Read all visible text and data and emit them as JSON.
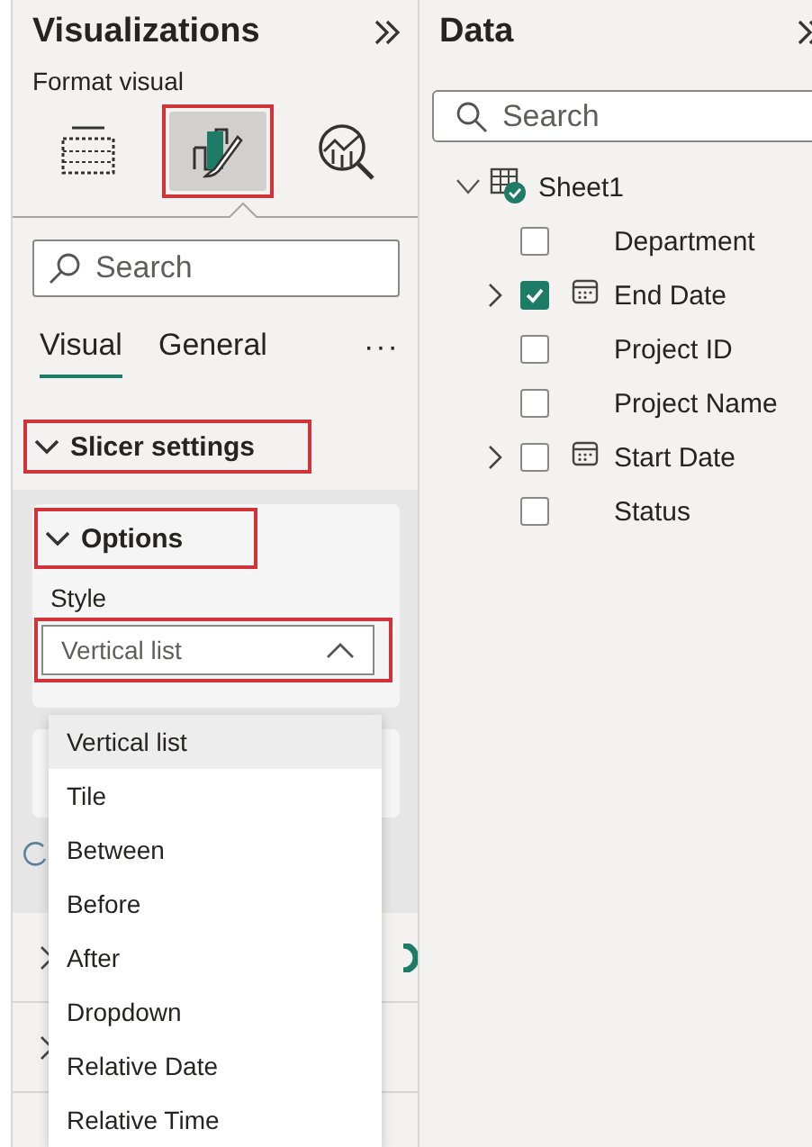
{
  "visualizations": {
    "title": "Visualizations",
    "subtitle": "Format visual",
    "icons": [
      {
        "kind": "build",
        "selected": false,
        "highlighted": false
      },
      {
        "kind": "format",
        "selected": true,
        "highlighted": true
      },
      {
        "kind": "analytics",
        "selected": false,
        "highlighted": false
      }
    ],
    "search": {
      "placeholder": "Search"
    },
    "tabs": [
      {
        "label": "Visual",
        "selected": true
      },
      {
        "label": "General",
        "selected": false
      }
    ],
    "more": "···",
    "section": {
      "title": "Slicer settings",
      "expanded": true,
      "highlighted": true
    },
    "options": {
      "title": "Options",
      "expanded": true,
      "highlighted": true
    },
    "style": {
      "label": "Style",
      "value": "Vertical list",
      "open": true,
      "highlighted": true
    },
    "collapsed_rows": [
      {
        "kind": "toggle"
      },
      {
        "kind": "plain"
      }
    ],
    "dropdown_options": [
      {
        "label": "Vertical list",
        "selected": true
      },
      {
        "label": "Tile",
        "selected": false
      },
      {
        "label": "Between",
        "selected": false
      },
      {
        "label": "Before",
        "selected": false
      },
      {
        "label": "After",
        "selected": false
      },
      {
        "label": "Dropdown",
        "selected": false
      },
      {
        "label": "Relative Date",
        "selected": false
      },
      {
        "label": "Relative Time",
        "selected": false
      }
    ]
  },
  "data": {
    "title": "Data",
    "search": {
      "placeholder": "Search"
    },
    "tree": [
      {
        "label": "Sheet1",
        "expanded": true,
        "children": [
          {
            "label": "Department",
            "kind": "field",
            "checked": false
          },
          {
            "label": "End Date",
            "kind": "date",
            "checked": true,
            "expanded": false
          },
          {
            "label": "Project ID",
            "kind": "field",
            "checked": false
          },
          {
            "label": "Project Name",
            "kind": "field",
            "checked": false
          },
          {
            "label": "Start Date",
            "kind": "date",
            "checked": false,
            "expanded": false
          },
          {
            "label": "Status",
            "kind": "field",
            "checked": false
          }
        ]
      }
    ]
  }
}
